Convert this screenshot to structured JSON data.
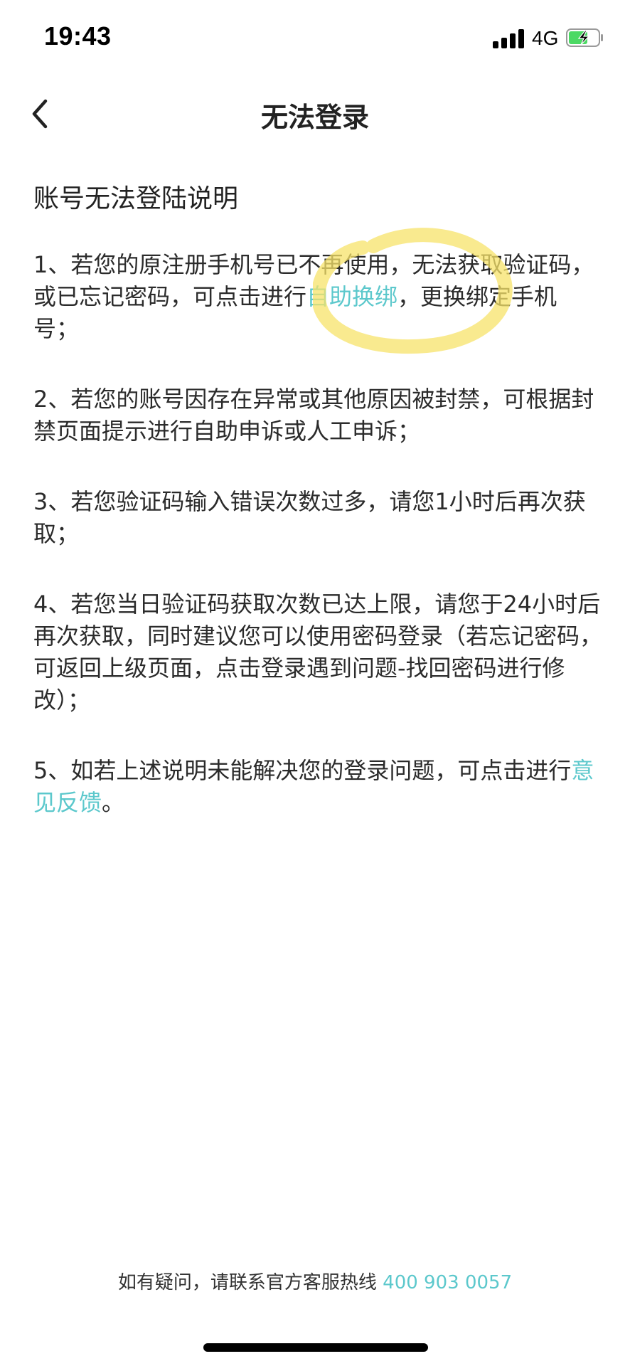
{
  "status_bar": {
    "time": "19:43",
    "network": "4G",
    "signal_icon": "signal-bars-icon",
    "battery_icon": "battery-charging-icon",
    "battery_color": "#4cd964"
  },
  "nav": {
    "title": "无法登录",
    "back_icon": "chevron-left-icon"
  },
  "content": {
    "heading": "账号无法登陆说明",
    "item1_before": "1、若您的原注册手机号已不再使用，无法获取验证码，或已忘记密码，可点击进行",
    "item1_link": "自助换绑",
    "item1_after": "，更换绑定手机号；",
    "item2": "2、若您的账号因存在异常或其他原因被封禁，可根据封禁页面提示进行自助申诉或人工申诉；",
    "item3": "3、若您验证码输入错误次数过多，请您1小时后再次获取；",
    "item4": "4、若您当日验证码获取次数已达上限，请您于24小时后再次获取，同时建议您可以使用密码登录（若忘记密码，可返回上级页面，点击登录遇到问题-找回密码进行修改）；",
    "item5_before": "5、如若上述说明未能解决您的登录问题，可点击进行",
    "item5_link": "意见反馈",
    "item5_after": "。"
  },
  "footer": {
    "text": "如有疑问，请联系官方客服热线",
    "phone": "400 903 0057"
  },
  "colors": {
    "accent": "#5cc8cc",
    "highlight_marker": "#f7e36a"
  }
}
